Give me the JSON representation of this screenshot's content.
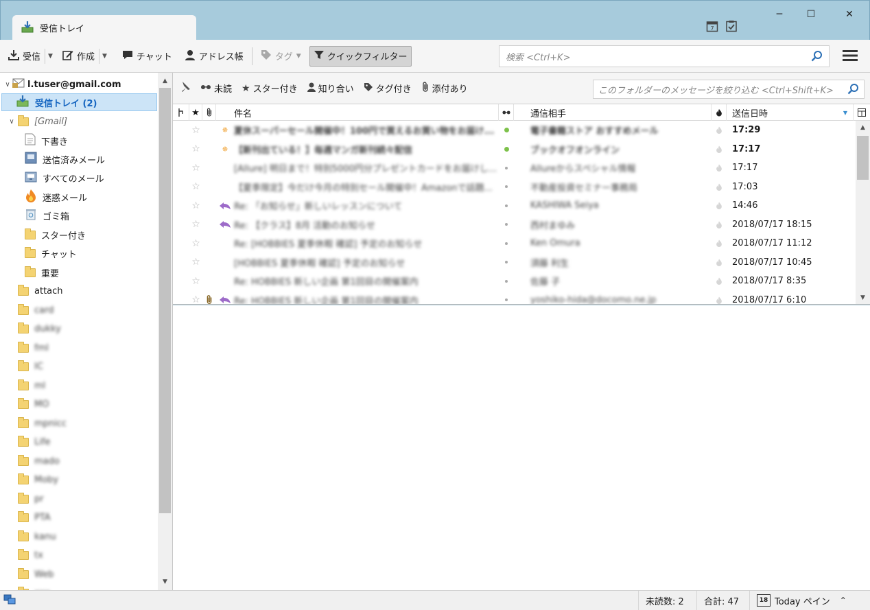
{
  "window": {
    "tab_title": "受信トレイ",
    "minimize": "─",
    "maximize": "☐",
    "close": "✕"
  },
  "toolbar": {
    "receive": "受信",
    "compose": "作成",
    "chat": "チャット",
    "address_book": "アドレス帳",
    "tag": "タグ",
    "quick_filter": "クイックフィルター",
    "search_placeholder": "検索 <Ctrl+K>"
  },
  "folders": {
    "account": "l.tuser@gmail.com",
    "inbox": "受信トレイ (2)",
    "gmail": "[Gmail]",
    "gmail_children": [
      "下書き",
      "送信済みメール",
      "すべてのメール",
      "迷惑メール",
      "ゴミ箱",
      "スター付き",
      "チャット",
      "重要"
    ],
    "attach": "attach",
    "others": [
      "card",
      "dukky",
      "fml",
      "IC",
      "ml",
      "MO",
      "mpnicc",
      "Life",
      "mado",
      "Moby",
      "pr",
      "PTA",
      "kanu",
      "tx",
      "Web",
      "xxx"
    ]
  },
  "quick_filter": {
    "unread": "未読",
    "starred": "スター付き",
    "contacts": "知り合い",
    "tagged": "タグ付き",
    "attachment": "添付あり",
    "placeholder": "このフォルダーのメッセージを絞り込む <Ctrl+Shift+K>"
  },
  "columns": {
    "subject": "件名",
    "correspondent": "通信相手",
    "date": "送信日時"
  },
  "messages": [
    {
      "subject": "夏休スーパーセール開催中！100円で買えるお買い物をお届け...",
      "from": "電子書籍ストア おすすめメール",
      "date": "17:29",
      "unread": true,
      "replied": false,
      "attach": false
    },
    {
      "subject": "【新刊出ている！】毎週マンガ新刊続々配信",
      "from": "ブックオフオンライン",
      "date": "17:17",
      "unread": true,
      "replied": false,
      "attach": false
    },
    {
      "subject": "[Allure] 明日まで！特別5000円分プレゼントカードをお届けし...",
      "from": "Allureからスペシャル情報",
      "date": "17:17",
      "unread": false,
      "replied": false,
      "attach": false
    },
    {
      "subject": "【夏季限定】今だけ今月の特別セール開催中！Amazonで話題...",
      "from": "不動産投資セミナー事務局",
      "date": "17:03",
      "unread": false,
      "replied": false,
      "attach": false
    },
    {
      "subject": "Re: 「お知らせ」新しいレッスンについて",
      "from": "KASHIWA Seiya",
      "date": "14:46",
      "unread": false,
      "replied": true,
      "attach": false
    },
    {
      "subject": "Re: 【クラス】8月 活動のお知らせ",
      "from": "西村まゆみ",
      "date": "2018/07/17 18:15",
      "unread": false,
      "replied": true,
      "attach": false
    },
    {
      "subject": "Re: [HOBBIES 夏季休暇 確認] 予定のお知らせ",
      "from": "Ken Omura",
      "date": "2018/07/17 11:12",
      "unread": false,
      "replied": false,
      "attach": false
    },
    {
      "subject": "[HOBBIES 夏季休暇 確認] 予定のお知らせ",
      "from": "須藤 利生",
      "date": "2018/07/17 10:45",
      "unread": false,
      "replied": false,
      "attach": false
    },
    {
      "subject": "Re: HOBBIES 新しい企画 第1回目の開催案内",
      "from": "佐藤 子",
      "date": "2018/07/17 8:35",
      "unread": false,
      "replied": false,
      "attach": false
    },
    {
      "subject": "Re: HOBBIES 新しい企画 第1回目の開催案内",
      "from": "yoshiko-hida@docomo.ne.jp",
      "date": "2018/07/17 6:10",
      "unread": false,
      "replied": true,
      "attach": true
    }
  ],
  "status": {
    "unread": "未読数: 2",
    "total": "合計: 47",
    "today_pane": "Today ペイン",
    "today_num": "18"
  }
}
